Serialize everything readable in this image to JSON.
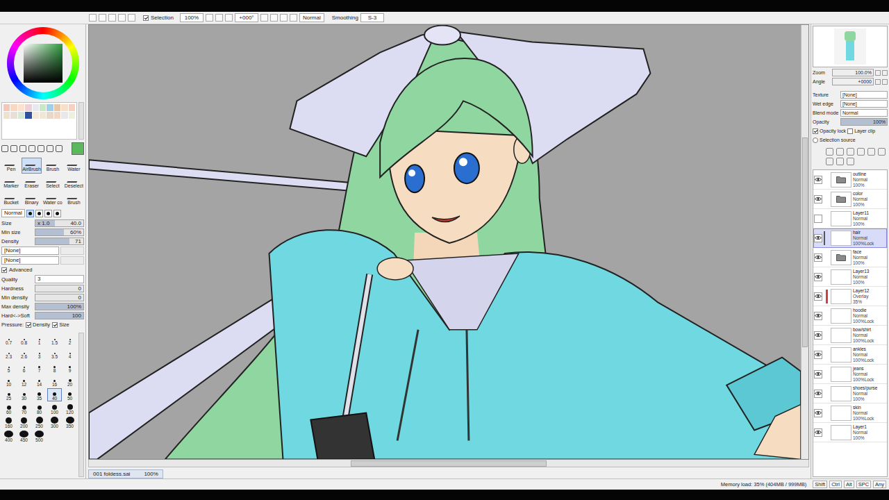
{
  "toolbar": {
    "selection": {
      "label": "Selection",
      "checked": true
    },
    "zoom": "100%",
    "angle": "+000°",
    "mode": "Normal",
    "smoothing_label": "Smoothing",
    "smoothing": "S-3"
  },
  "color": {
    "current": "#5cb85c",
    "hue": "#2f9e3f"
  },
  "swatches": [
    "#f4c8b8",
    "#f8d8c0",
    "#fce0d0",
    "#f0d0d8",
    "#e8e8f0",
    "#c8e8c8",
    "#a0d0e8",
    "#e8c8a8",
    "#f8e0c8",
    "#f8d0c0",
    "#f0e0d0",
    "#e8e0d8",
    "#d8e8d8",
    "#3050a0",
    "#f8e8d8",
    "#f0e8d0",
    "#e8d8c8",
    "#f0d8c8",
    "#e8e8e8",
    "#f0f0e0"
  ],
  "tools": [
    {
      "label": "Pen",
      "selected": false
    },
    {
      "label": "AirBrush",
      "selected": true
    },
    {
      "label": "Brush",
      "selected": false
    },
    {
      "label": "Water",
      "selected": false
    },
    {
      "label": "Marker",
      "selected": false
    },
    {
      "label": "Eraser",
      "selected": false
    },
    {
      "label": "Select",
      "selected": false
    },
    {
      "label": "Deselect",
      "selected": false
    },
    {
      "label": "Bucket",
      "selected": false
    },
    {
      "label": "Binary",
      "selected": false
    },
    {
      "label": "Water co",
      "selected": false
    },
    {
      "label": "Brush",
      "selected": false
    }
  ],
  "brush": {
    "mode": "Normal",
    "shapes": [
      {
        "selected": true
      },
      {
        "selected": false
      },
      {
        "selected": false
      },
      {
        "selected": false
      }
    ],
    "sliders": [
      {
        "label": "Size",
        "prefix": "x 1.0",
        "value": "40.0",
        "level": 0.4
      },
      {
        "label": "Min size",
        "prefix": "",
        "value": "60%",
        "level": 0.6
      },
      {
        "label": "Density",
        "prefix": "",
        "value": "71",
        "level": 0.71
      }
    ],
    "textures": [
      "[None]",
      "[None]"
    ],
    "advanced": {
      "label": "Advanced",
      "checked": true
    },
    "quality": {
      "label": "Quality",
      "value": "3"
    },
    "advanced_sliders": [
      {
        "label": "Hardness",
        "value": "0",
        "level": 0
      },
      {
        "label": "Min density",
        "value": "0",
        "level": 0
      },
      {
        "label": "Max density",
        "value": "100%",
        "level": 1
      },
      {
        "label": "Hard<->Soft",
        "value": "100",
        "level": 1
      }
    ],
    "pressure": {
      "label": "Pressure:",
      "options": [
        {
          "label": "Density",
          "checked": true
        },
        {
          "label": "Size",
          "checked": true
        }
      ]
    },
    "sizes": [
      {
        "label": "0.7",
        "selected": false
      },
      {
        "label": "0.8",
        "selected": false
      },
      {
        "label": "1",
        "selected": false
      },
      {
        "label": "1.5",
        "selected": false
      },
      {
        "label": "2",
        "selected": false
      },
      {
        "label": "2.3",
        "selected": false
      },
      {
        "label": "2.6",
        "selected": false
      },
      {
        "label": "3",
        "selected": false
      },
      {
        "label": "3.5",
        "selected": false
      },
      {
        "label": "4",
        "selected": false
      },
      {
        "label": "5",
        "selected": false
      },
      {
        "label": "6",
        "selected": false
      },
      {
        "label": "7",
        "selected": false
      },
      {
        "label": "8",
        "selected": false
      },
      {
        "label": "9",
        "selected": false
      },
      {
        "label": "10",
        "selected": false
      },
      {
        "label": "12",
        "selected": false
      },
      {
        "label": "14",
        "selected": false
      },
      {
        "label": "16",
        "selected": false
      },
      {
        "label": "20",
        "selected": false
      },
      {
        "label": "25",
        "selected": false
      },
      {
        "label": "30",
        "selected": false
      },
      {
        "label": "35",
        "selected": false
      },
      {
        "label": "40",
        "selected": true
      },
      {
        "label": "50",
        "selected": false
      },
      {
        "label": "60",
        "selected": false
      },
      {
        "label": "70",
        "selected": false
      },
      {
        "label": "80",
        "selected": false
      },
      {
        "label": "100",
        "selected": false
      },
      {
        "label": "120",
        "selected": false
      },
      {
        "label": "160",
        "selected": false
      },
      {
        "label": "200",
        "selected": false
      },
      {
        "label": "250",
        "selected": false
      },
      {
        "label": "300",
        "selected": false
      },
      {
        "label": "350",
        "selected": false
      },
      {
        "label": "400",
        "selected": false
      },
      {
        "label": "450",
        "selected": false
      },
      {
        "label": "500",
        "selected": false
      }
    ]
  },
  "document": {
    "tab": "001 foldess.sai",
    "zoom": "100%"
  },
  "navigator": {
    "zoom_label": "Zoom",
    "zoom": "100.0%",
    "angle_label": "Angle",
    "angle": "+0000"
  },
  "layer_props": {
    "texture_label": "Texture",
    "texture": "[None]",
    "wet_label": "Wet edge",
    "wet": "[None]",
    "blend_label": "Blend mode",
    "blend": "Normal",
    "opacity_label": "Opacity",
    "opacity": "100%",
    "opacity_level": 1,
    "checks": [
      {
        "label": "Opacity lock",
        "checked": true
      },
      {
        "label": "Layer clip",
        "checked": false
      }
    ],
    "source": {
      "label": "Selection source",
      "selected": false
    }
  },
  "layers": {
    "lock_label": "Lock",
    "items": [
      {
        "name": "outline",
        "mode": "Normal",
        "opacity": "100%",
        "kind": "folder",
        "visible": true,
        "selected": false,
        "locked": false,
        "clipped": false
      },
      {
        "name": "color",
        "mode": "Normal",
        "opacity": "100%",
        "kind": "folder",
        "visible": true,
        "selected": false,
        "locked": false,
        "clipped": false
      },
      {
        "name": "Layer11",
        "mode": "Normal",
        "opacity": "100%",
        "kind": "layer",
        "visible": false,
        "selected": false,
        "locked": false,
        "clipped": false
      },
      {
        "name": "hair",
        "mode": "Normal",
        "opacity": "100%",
        "kind": "layer",
        "visible": true,
        "selected": true,
        "locked": true,
        "clipped": false
      },
      {
        "name": "face",
        "mode": "Normal",
        "opacity": "100%",
        "kind": "folder",
        "visible": true,
        "selected": false,
        "locked": false,
        "clipped": false
      },
      {
        "name": "Layer13",
        "mode": "Normal",
        "opacity": "100%",
        "kind": "layer",
        "visible": true,
        "selected": false,
        "locked": false,
        "clipped": false
      },
      {
        "name": "Layer12",
        "mode": "Overlay",
        "opacity": "35%",
        "kind": "layer",
        "visible": true,
        "selected": false,
        "locked": false,
        "clipped": true
      },
      {
        "name": "hoodie",
        "mode": "Normal",
        "opacity": "100%",
        "kind": "layer",
        "visible": true,
        "selected": false,
        "locked": true,
        "clipped": false
      },
      {
        "name": "bow/shirt",
        "mode": "Normal",
        "opacity": "100%",
        "kind": "layer",
        "visible": true,
        "selected": false,
        "locked": true,
        "clipped": false
      },
      {
        "name": "ankles",
        "mode": "Normal",
        "opacity": "100%",
        "kind": "layer",
        "visible": true,
        "selected": false,
        "locked": true,
        "clipped": false
      },
      {
        "name": "jeans",
        "mode": "Normal",
        "opacity": "100%",
        "kind": "layer",
        "visible": true,
        "selected": false,
        "locked": true,
        "clipped": false
      },
      {
        "name": "shoes/purse",
        "mode": "Normal",
        "opacity": "100%",
        "kind": "layer",
        "visible": true,
        "selected": false,
        "locked": false,
        "clipped": false
      },
      {
        "name": "skin",
        "mode": "Normal",
        "opacity": "100%",
        "kind": "layer",
        "visible": true,
        "selected": false,
        "locked": true,
        "clipped": false
      },
      {
        "name": "Layer1",
        "mode": "Normal",
        "opacity": "100%",
        "kind": "layer",
        "visible": true,
        "selected": false,
        "locked": false,
        "clipped": false
      }
    ]
  },
  "status": {
    "memory": "Memory load: 35% (404MB / 999MB)",
    "keys": [
      "Shift",
      "Ctrl",
      "Alt",
      "SPC",
      "Any"
    ]
  }
}
